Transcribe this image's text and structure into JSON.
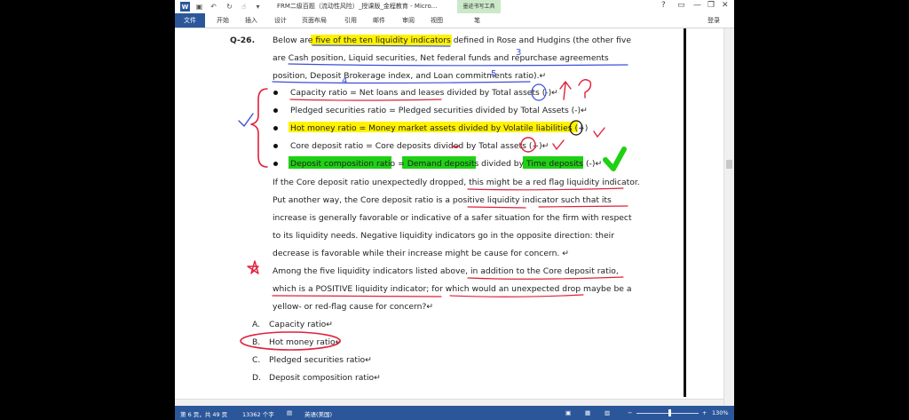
{
  "titlebar": {
    "title": "FRM二级百题（流动性风险）_授课版_金程教育 - Micro...",
    "context_tab": "墨迹书写工具",
    "help": "?",
    "minimize": "—",
    "restore": "❐",
    "close": "✕"
  },
  "ribbon": {
    "file": "文件",
    "tabs": [
      "开始",
      "插入",
      "设计",
      "页面布局",
      "引用",
      "邮件",
      "审阅",
      "视图"
    ],
    "context_sub": "笔",
    "login": "登录"
  },
  "document": {
    "q_number": "Q-26.",
    "intro": [
      "Below are five of the ten liquidity indicators defined in Rose and Hudgins (the other five",
      "are Cash position, Liquid securities, Net federal funds and repurchase agreements",
      "position, Deposit Brokerage index, and Loan commitments ratio).↵"
    ],
    "bullets": [
      "Capacity ratio = Net loans and leases divided by Total assets (-)↵",
      "Pledged securities ratio = Pledged securities divided by Total Assets (-)↵",
      "Hot money ratio = Money market assets divided by Volatile liabilities (+)",
      "Core deposit ratio = Core deposits divided by Total assets (+)↵",
      "Deposit composition ratio = Demand deposits divided by Time deposits (-)↵"
    ],
    "paragraph": [
      "If the Core deposit ratio unexpectedly dropped, this might be a red flag liquidity indicator.",
      "Put another way, the Core deposit ratio is a positive liquidity indicator such that its",
      "increase is generally favorable or indicative of a safer situation for the firm with respect",
      "to its liquidity needs. Negative liquidity indicators go in the opposite direction: their",
      "decrease is favorable while their increase might be cause for concern.  ↵"
    ],
    "question": [
      "Among the five liquidity indicators listed above, in addition to the Core deposit ratio,",
      "which is a POSITIVE liquidity indicator; for which would an unexpected drop maybe be a",
      "yellow- or red-flag cause for concern?↵"
    ],
    "options": [
      {
        "letter": "A.",
        "text": "Capacity ratio↵"
      },
      {
        "letter": "B.",
        "text": "Hot money ratio↵"
      },
      {
        "letter": "C.",
        "text": "Pledged securities ratio↵"
      },
      {
        "letter": "D.",
        "text": "Deposit composition ratio↵"
      }
    ],
    "ink_numbers": [
      "3",
      "4",
      "5"
    ]
  },
  "statusbar": {
    "page": "第 6 页，共 49 页",
    "words": "13362 个字",
    "language": "英语(美国)",
    "zoom": "130%",
    "zoom_minus": "−",
    "zoom_plus": "+"
  },
  "colors": {
    "accent": "#2b579a",
    "highlight_yellow": "#fff200",
    "highlight_green": "#1fd114",
    "ink_red": "#e0203a",
    "ink_blue": "#3a4fd8"
  }
}
